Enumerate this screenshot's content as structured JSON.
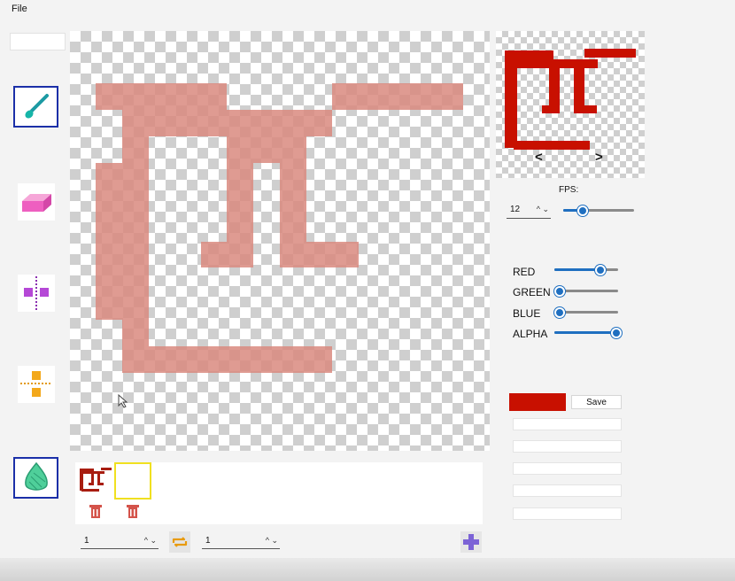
{
  "menu": {
    "file": "File"
  },
  "tools": [
    {
      "name": "brush",
      "selected": true,
      "icon": "brush-icon"
    },
    {
      "name": "eraser",
      "selected": false,
      "icon": "eraser-icon"
    },
    {
      "name": "mirror-vertical",
      "selected": false,
      "icon": "mirror-vertical-icon"
    },
    {
      "name": "mirror-horizontal",
      "selected": false,
      "icon": "mirror-horizontal-icon"
    },
    {
      "name": "fill",
      "selected": true,
      "icon": "fill-bucket-icon"
    }
  ],
  "preview": {
    "prev": "<",
    "next": ">"
  },
  "fps": {
    "label": "FPS:",
    "value": "12",
    "slider_fraction": 0.27
  },
  "color": {
    "channels": [
      {
        "label": "RED",
        "fraction": 0.72
      },
      {
        "label": "GREEN",
        "fraction": 0.0
      },
      {
        "label": "BLUE",
        "fraction": 0.0
      },
      {
        "label": "ALPHA",
        "fraction": 1.0
      }
    ],
    "current": "#c81000",
    "save_label": "Save"
  },
  "frames": {
    "count_visible": 2,
    "selected_index": 1
  },
  "playback": {
    "start_frame": "1",
    "end_frame": "1"
  },
  "colors": {
    "accent": "#1f6fc0",
    "pixel": "#c81000",
    "selection": "#1b2fa8",
    "frame_highlight": "#f0e020"
  }
}
